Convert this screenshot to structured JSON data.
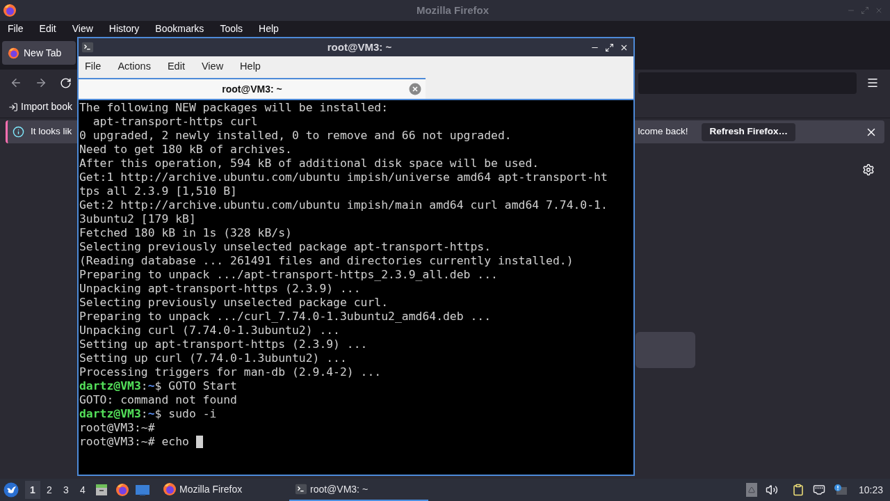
{
  "firefox": {
    "title": "Mozilla Firefox",
    "menu": [
      {
        "label": "File"
      },
      {
        "label": "Edit"
      },
      {
        "label": "View"
      },
      {
        "label": "History"
      },
      {
        "label": "Bookmarks"
      },
      {
        "label": "Tools"
      },
      {
        "label": "Help"
      }
    ],
    "tabs": [
      {
        "label": "New Tab",
        "selected": true
      }
    ],
    "bookmarks": [
      {
        "label": "Import book"
      }
    ],
    "notification": {
      "message": "It looks lik",
      "message_end": "lcome back!",
      "button": "Refresh Firefox…"
    }
  },
  "terminal": {
    "title": "root@VM3: ~",
    "menu": [
      {
        "label": "File"
      },
      {
        "label": "Actions"
      },
      {
        "label": "Edit"
      },
      {
        "label": "View"
      },
      {
        "label": "Help"
      }
    ],
    "tabs": [
      {
        "label": "root@VM3: ~",
        "selected": true
      }
    ],
    "lines": [
      {
        "kind": "output",
        "text": "The following NEW packages will be installed:"
      },
      {
        "kind": "output",
        "text": "  apt-transport-https curl"
      },
      {
        "kind": "output",
        "text": "0 upgraded, 2 newly installed, 0 to remove and 66 not upgraded."
      },
      {
        "kind": "output",
        "text": "Need to get 180 kB of archives."
      },
      {
        "kind": "output",
        "text": "After this operation, 594 kB of additional disk space will be used."
      },
      {
        "kind": "output",
        "text": "Get:1 http://archive.ubuntu.com/ubuntu impish/universe amd64 apt-transport-ht"
      },
      {
        "kind": "output",
        "text": "tps all 2.3.9 [1,510 B]"
      },
      {
        "kind": "output",
        "text": "Get:2 http://archive.ubuntu.com/ubuntu impish/main amd64 curl amd64 7.74.0-1."
      },
      {
        "kind": "output",
        "text": "3ubuntu2 [179 kB]"
      },
      {
        "kind": "output",
        "text": "Fetched 180 kB in 1s (328 kB/s)"
      },
      {
        "kind": "output",
        "text": "Selecting previously unselected package apt-transport-https."
      },
      {
        "kind": "output",
        "text": "(Reading database ... 261491 files and directories currently installed.)"
      },
      {
        "kind": "output",
        "text": "Preparing to unpack .../apt-transport-https_2.3.9_all.deb ..."
      },
      {
        "kind": "output",
        "text": "Unpacking apt-transport-https (2.3.9) ..."
      },
      {
        "kind": "output",
        "text": "Selecting previously unselected package curl."
      },
      {
        "kind": "output",
        "text": "Preparing to unpack .../curl_7.74.0-1.3ubuntu2_amd64.deb ..."
      },
      {
        "kind": "output",
        "text": "Unpacking curl (7.74.0-1.3ubuntu2) ..."
      },
      {
        "kind": "output",
        "text": "Setting up apt-transport-https (2.3.9) ..."
      },
      {
        "kind": "output",
        "text": "Setting up curl (7.74.0-1.3ubuntu2) ..."
      },
      {
        "kind": "output",
        "text": "Processing triggers for man-db (2.9.4-2) ..."
      },
      {
        "kind": "prompt",
        "user": "dartz@VM3",
        "sep": ":",
        "path": "~",
        "text": "$ GOTO Start"
      },
      {
        "kind": "output",
        "text": "GOTO: command not found"
      },
      {
        "kind": "prompt",
        "user": "dartz@VM3",
        "sep": ":",
        "path": "~",
        "text": "$ sudo -i"
      },
      {
        "kind": "output",
        "text": "root@VM3:~#"
      },
      {
        "kind": "output",
        "text": "root@VM3:~# echo ",
        "cursor": true
      }
    ]
  },
  "taskbar": {
    "workspaces": [
      {
        "label": "1",
        "selected": true
      },
      {
        "label": "2",
        "selected": false
      },
      {
        "label": "3",
        "selected": false
      },
      {
        "label": "4",
        "selected": false
      }
    ],
    "tasks": [
      {
        "label": "Mozilla Firefox",
        "selected": false
      },
      {
        "label": "root@VM3: ~",
        "selected": true
      }
    ],
    "clock": "10:23"
  }
}
